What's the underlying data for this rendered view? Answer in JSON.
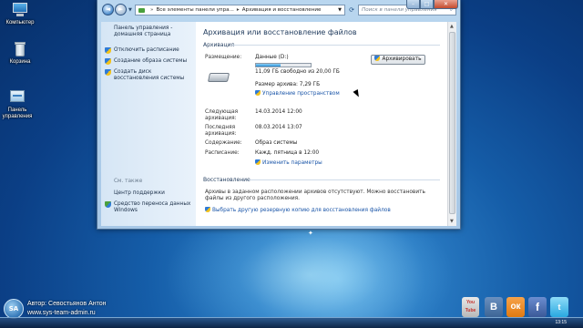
{
  "desktop": {
    "icons": [
      {
        "label": "Компьютер"
      },
      {
        "label": "Корзина"
      },
      {
        "label": "Панель управления"
      }
    ]
  },
  "window": {
    "breadcrumb": [
      "Все элементы панели упра...",
      "Архивация и восстановление"
    ],
    "search_placeholder": "Поиск в панели управления",
    "controls": {
      "minimize": "–",
      "maximize": "□",
      "close": "✕"
    }
  },
  "sidebar": {
    "home_link": "Панель управления - домашняя страница",
    "tasks": [
      {
        "label": "Отключить расписание"
      },
      {
        "label": "Создание образа системы"
      },
      {
        "label": "Создать диск восстановления системы"
      }
    ],
    "see_also_title": "См. также",
    "see_also": [
      {
        "label": "Центр поддержки"
      },
      {
        "label": "Средство переноса данных Windows"
      }
    ]
  },
  "content": {
    "title": "Архивация или восстановление файлов",
    "backup_section": {
      "heading": "Архивация",
      "location_label": "Размещение:",
      "drive_name": "Данные (D:)",
      "free_space": "11,09 ГБ свободно из 20,00 ГБ",
      "usage_fraction": 0.45,
      "backup_size": "Размер архива: 7,29 ГБ",
      "manage_space_link": "Управление пространством",
      "backup_now_button": "Архивировать",
      "next_backup_label": "Следующая архивация:",
      "next_backup_value": "14.03.2014 12:00",
      "last_backup_label": "Последняя архивация:",
      "last_backup_value": "08.03.2014 13:07",
      "contents_label": "Содержание:",
      "contents_value": "Образ системы",
      "schedule_label": "Расписание:",
      "schedule_value": "Кажд. пятница в 12:00",
      "change_settings_link": "Изменить параметры"
    },
    "restore_section": {
      "heading": "Восстановление",
      "message": "Архивы в заданном расположении архивов отсутствуют. Можно восстановить файлы из другого расположения.",
      "select_other_link": "Выбрать другую резервную копию для восстановления файлов"
    }
  },
  "watermark": {
    "logo_text": "SA",
    "author": "Автор: Севостьянов Антон",
    "site": "www.sys-team-admin.ru"
  },
  "social": {
    "youtube": "You Tube",
    "vk": "В",
    "ok": "ок",
    "facebook": "f",
    "twitter": "t"
  },
  "taskbar": {
    "clock": "13:15"
  }
}
